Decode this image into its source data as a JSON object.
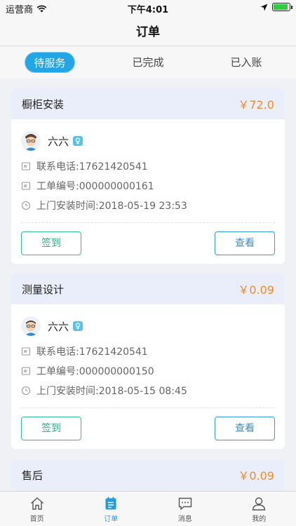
{
  "status_bar": {
    "carrier": "运营商",
    "time": "下午4:01"
  },
  "nav": {
    "title": "订单"
  },
  "tabs": [
    {
      "label": "待服务",
      "active": true
    },
    {
      "label": "已完成",
      "active": false
    },
    {
      "label": "已入账",
      "active": false
    }
  ],
  "orders": [
    {
      "title": "橱柜安装",
      "price": "￥72.0",
      "name": "六六",
      "phone": "联系电话:17621420541",
      "order_no": "工单编号:000000000161",
      "visit_time": "上门安装时间:2018-05-19 23:53",
      "sign_label": "签到",
      "view_label": "查看"
    },
    {
      "title": "测量设计",
      "price": "￥0.09",
      "name": "六六",
      "phone": "联系电话:17621420541",
      "order_no": "工单编号:000000000150",
      "visit_time": "上门安装时间:2018-05-15 08:45",
      "sign_label": "签到",
      "view_label": "查看"
    },
    {
      "title": "售后",
      "price": "￥0.09"
    }
  ],
  "tabbar": [
    {
      "label": "首页",
      "icon": "home-icon",
      "active": false
    },
    {
      "label": "订单",
      "icon": "order-icon",
      "active": true
    },
    {
      "label": "消息",
      "icon": "message-icon",
      "active": false
    },
    {
      "label": "我的",
      "icon": "user-icon",
      "active": false
    }
  ],
  "colors": {
    "accent": "#23a6e6",
    "price": "#f08b2a",
    "sign": "#2fc08f",
    "view": "#2f9fe0",
    "card_head": "#e9eefa"
  }
}
